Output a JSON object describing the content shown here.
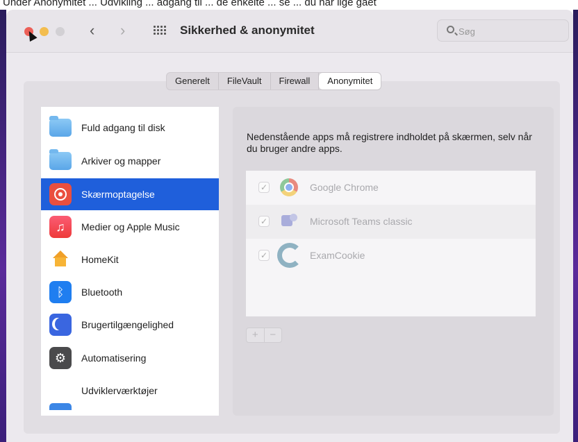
{
  "caption": "Under Anonymitet ... Udvikling ... adgang til ... de enkelte ... se ... du har lige gået",
  "window": {
    "title": "Sikkerhed & anonymitet",
    "search_placeholder": "Søg"
  },
  "tabs": [
    {
      "label": "Generelt",
      "active": false
    },
    {
      "label": "FileVault",
      "active": false
    },
    {
      "label": "Firewall",
      "active": false
    },
    {
      "label": "Anonymitet",
      "active": true
    }
  ],
  "sidebar": {
    "items": [
      {
        "label": "Fuld adgang til disk",
        "icon": "folder-icon"
      },
      {
        "label": "Arkiver og mapper",
        "icon": "folder-icon"
      },
      {
        "label": "Skærmoptagelse",
        "icon": "screen-recording-icon",
        "selected": true
      },
      {
        "label": "Medier og Apple Music",
        "icon": "music-icon"
      },
      {
        "label": "HomeKit",
        "icon": "home-icon"
      },
      {
        "label": "Bluetooth",
        "icon": "bluetooth-icon"
      },
      {
        "label": "Brugertilgængelighed",
        "icon": "accessibility-icon"
      },
      {
        "label": "Automatisering",
        "icon": "gear-icon"
      },
      {
        "label": "Udviklerværktøjer",
        "icon": ""
      }
    ]
  },
  "content": {
    "description": "Nedenstående apps må registrere indholdet på skærmen, selv når du bruger andre apps.",
    "apps": [
      {
        "name": "Google Chrome",
        "checked": true,
        "icon": "chrome-icon"
      },
      {
        "name": "Microsoft Teams classic",
        "checked": true,
        "icon": "teams-icon"
      },
      {
        "name": "ExamCookie",
        "checked": true,
        "icon": "examcookie-icon"
      }
    ],
    "add_label": "+",
    "remove_label": "−"
  },
  "icons": {
    "back": "‹",
    "forward": "›",
    "check": "✓",
    "music": "♫",
    "bluetooth": "ᛒ",
    "gear": "⚙"
  },
  "colors": {
    "accent": "#1f5fdb",
    "close": "#ec5f57",
    "minimize": "#f3bd4f"
  }
}
